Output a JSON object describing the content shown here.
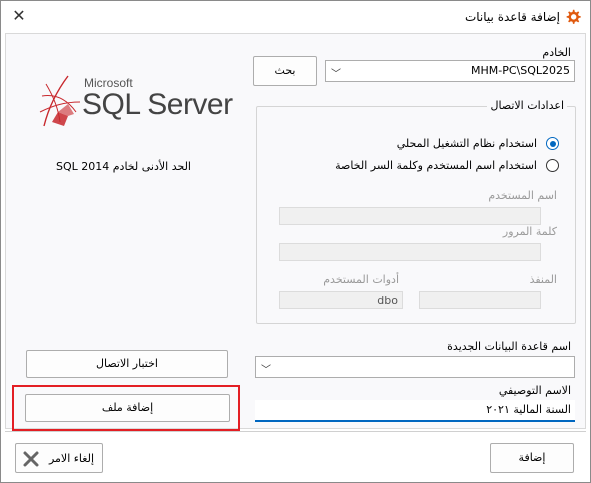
{
  "window": {
    "title": "إضافة قاعدة بيانات"
  },
  "server": {
    "label": "الخادم",
    "value": "MHM-PC\\SQL2025",
    "browse_label": "بحث"
  },
  "logo": {
    "company": "Microsoft",
    "product": "SQL Server"
  },
  "min_version_text": "الحد الأدنى لخادم SQL 2014",
  "connection": {
    "group_title": "اعدادات الاتصال",
    "option_windows": "استخدام نظام التشغيل المحلي",
    "option_sql": "استخدام اسم المستخدم وكلمة السر الخاصة",
    "selected": "windows",
    "username_label": "اسم المستخدم",
    "username_value": "",
    "password_label": "كلمة المرور",
    "password_value": "",
    "port_label": "المنفذ",
    "port_value": "",
    "user_tools_label": "أدوات المستخدم",
    "user_tools_value": "dbo"
  },
  "test_connection_label": "اختبار الاتصال",
  "new_db": {
    "label": "اسم قاعدة البيانات الجديدة",
    "value": ""
  },
  "description": {
    "label": "الاسم التوصيفي",
    "value": "السنة المالية ٢٠٢١"
  },
  "add_file_label": "إضافة ملف",
  "footer": {
    "add_label": "إضافة",
    "cancel_label": "إلغاء الامر"
  },
  "colors": {
    "accent": "#0067c0",
    "highlight": "#e31e24",
    "logo_red": "#c8282d"
  }
}
